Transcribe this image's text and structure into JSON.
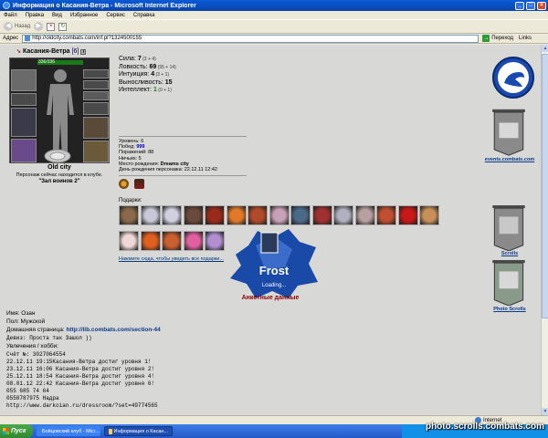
{
  "window": {
    "title": "Информация о Касания-Ветра - Microsoft Internet Explorer",
    "min": "_",
    "max": "□",
    "close": "×"
  },
  "menu": [
    "Файл",
    "Правка",
    "Вид",
    "Избранное",
    "Сервис",
    "Справка"
  ],
  "toolbar": {
    "back": "Назад",
    "forward": ""
  },
  "address": {
    "label": "Адрес",
    "url": "http://oldcity.combats.com/inf.pl?1324500155",
    "go": "Переход",
    "links": "Links"
  },
  "character": {
    "name": "Касания-Ветра",
    "level": "[6]",
    "hp": "336/336",
    "city": "Old city",
    "club_line1": "Персонаж сейчас находится в клубе.",
    "club_line2": "\"Зал воинов 2\""
  },
  "stats": [
    {
      "label": "Сила: ",
      "value": "7",
      "bonus": " (3 + 4)",
      "green": false
    },
    {
      "label": "Ловкость: ",
      "value": "69",
      "bonus": " (55 + 14)",
      "green": false
    },
    {
      "label": "Интуиция: ",
      "value": "4",
      "bonus": " (3 + 1)",
      "green": false
    },
    {
      "label": "Выносливость: ",
      "value": "15",
      "bonus": "",
      "green": false
    },
    {
      "label": "Интеллект: ",
      "value": "1",
      "bonus": " (0 + 1)",
      "green": true
    }
  ],
  "info": {
    "level": "Уровень: 6",
    "wins_label": "Побед: ",
    "wins": "999",
    "losses": "Поражений: 88",
    "draws": "Ничьих: 5",
    "birthplace_label": "Место рождения: ",
    "birthplace": "Dreams city",
    "birthday": "День рождения персонажа: 22.12.11 12:42"
  },
  "gifts": {
    "label": "Подарки:",
    "link": "Нажмите сюда, чтобы увидеть все подарки...",
    "colors": [
      "#8a6a4a",
      "#c8c8d8",
      "#d0d0e0",
      "#6a4a3a",
      "#9a2a1a",
      "#e07a2a",
      "#b04a2a",
      "#c8a0b8",
      "#4a6a8a",
      "#a03030",
      "#b0b0c0",
      "#b8a0a0",
      "#c05030",
      "#c81818",
      "#c89058",
      "#f0d8d8",
      "#e06020",
      "#c86030",
      "#e060a0",
      "#b090d0"
    ]
  },
  "frost": {
    "title": "Frost",
    "sub": "Loading..."
  },
  "right": {
    "events": "events.combats.com",
    "scrolls": "Scrolls",
    "photo": "Photo Scrolls"
  },
  "anketa": {
    "title": "Анкетные данные",
    "name": "Имя: Озан",
    "sex": "Пол: Мужской",
    "homepage_label": "Домашняя страница: ",
    "homepage": "http://lib.combats.com/section-44",
    "motto": "Девиз: Проста так Зашол ))",
    "hobby": "Увлечения / хобби:",
    "account": "Счёт №: 3027064554"
  },
  "log": [
    "22.12.11 19:15Касания-Ветра достиг уровня 1!",
    "23.12.11 16:06 Касания-Ветра достиг уровня 2!",
    "25.12.11 18:54 Касания-Ветра достиг уровня 4!",
    "08.01.12 22:42 Касания-Ветра достиг уровня 6!",
    "055 685 74 64",
    "0558787975 Надра",
    "http://www.darkoian.ru/dressroom/?set=49774565"
  ],
  "status": {
    "zone": "Internet"
  },
  "taskbar": {
    "start": "Пуск",
    "task1": "Бойцовский клуб - Micr...",
    "task2": "Информация о Касан..."
  },
  "watermark": "photo.scrolls.combats.com"
}
